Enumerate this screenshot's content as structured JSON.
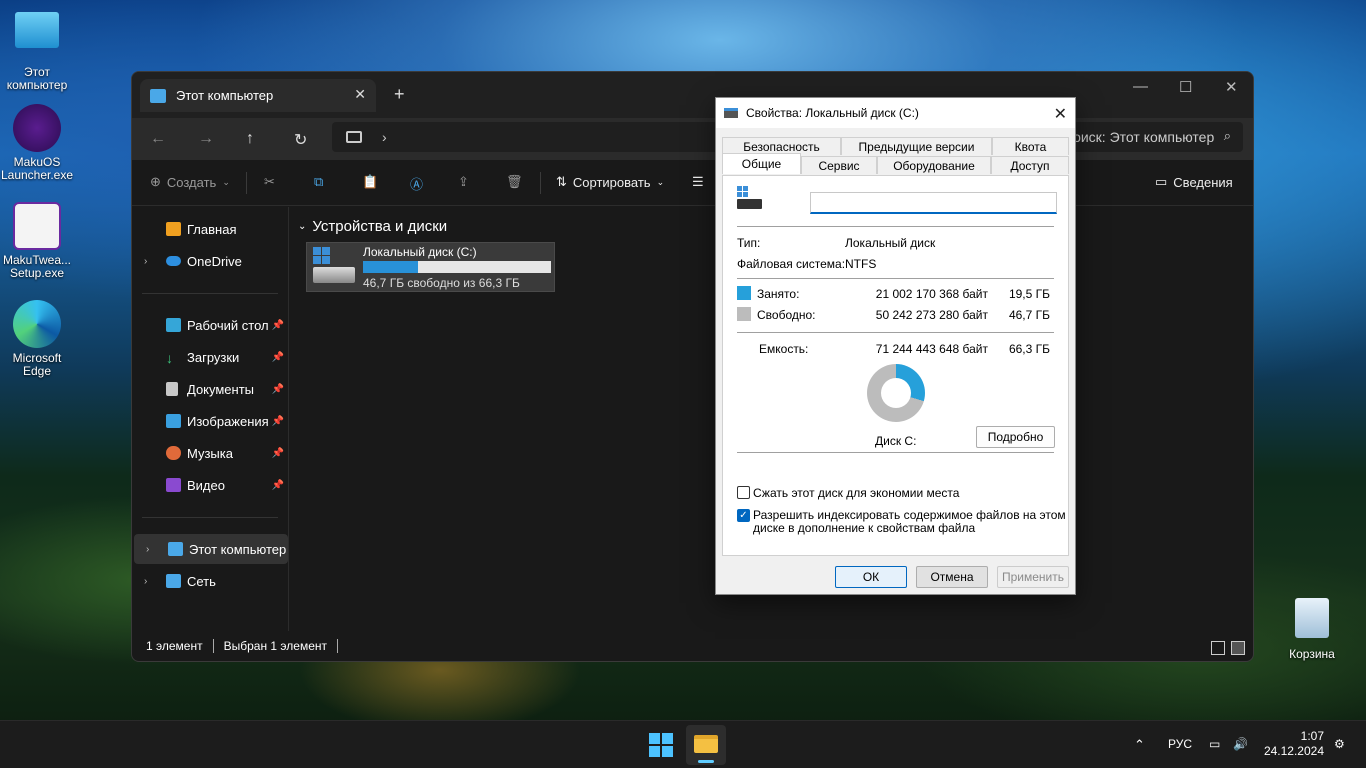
{
  "desktop": {
    "icons": [
      {
        "label": "Этот компьютер"
      },
      {
        "label": "MakuOS Launcher.exe"
      },
      {
        "label": "MakuTwea... Setup.exe"
      },
      {
        "label": "Microsoft Edge"
      },
      {
        "label": "Корзина"
      }
    ]
  },
  "explorer": {
    "tab_title": "Этот компьютер",
    "search_placeholder": "Поиск: Этот компьютер",
    "toolbar": {
      "create": "Создать",
      "sort": "Сортировать",
      "details": "Сведения"
    },
    "sidebar": [
      {
        "label": "Главная"
      },
      {
        "label": "OneDrive"
      },
      {
        "label": "Рабочий стол"
      },
      {
        "label": "Загрузки"
      },
      {
        "label": "Документы"
      },
      {
        "label": "Изображения"
      },
      {
        "label": "Музыка"
      },
      {
        "label": "Видео"
      },
      {
        "label": "Этот компьютер"
      },
      {
        "label": "Сеть"
      }
    ],
    "group_title": "Устройства и диски",
    "drive": {
      "name": "Локальный диск (C:)",
      "free_text": "46,7 ГБ свободно из 66,3 ГБ",
      "used_fraction": 0.295
    },
    "status": {
      "count": "1 элемент",
      "selected": "Выбран 1 элемент"
    }
  },
  "dialog": {
    "title": "Свойства: Локальный диск (C:)",
    "tabs_top": [
      "Безопасность",
      "Предыдущие версии",
      "Квота"
    ],
    "tabs_bottom": [
      "Общие",
      "Сервис",
      "Оборудование",
      "Доступ"
    ],
    "type_label": "Тип:",
    "type_value": "Локальный диск",
    "fs_label": "Файловая система:",
    "fs_value": "NTFS",
    "used_label": "Занято:",
    "used_bytes": "21 002 170 368 байт",
    "used_gb": "19,5 ГБ",
    "free_label": "Свободно:",
    "free_bytes": "50 242 273 280 байт",
    "free_gb": "46,7 ГБ",
    "capacity_label": "Емкость:",
    "capacity_bytes": "71 244 443 648 байт",
    "capacity_gb": "66,3 ГБ",
    "disk_label": "Диск C:",
    "details_button": "Подробно",
    "compress_label": "Сжать этот диск для экономии места",
    "index_label_1": "Разрешить индексировать содержимое файлов на этом",
    "index_label_2": "диске в дополнение к свойствам файла",
    "ok": "ОК",
    "cancel": "Отмена",
    "apply": "Применить",
    "used_color": "#26a0da",
    "free_color": "#bcbcbc"
  },
  "taskbar": {
    "lang": "РУС",
    "time": "1:07",
    "date": "24.12.2024"
  }
}
